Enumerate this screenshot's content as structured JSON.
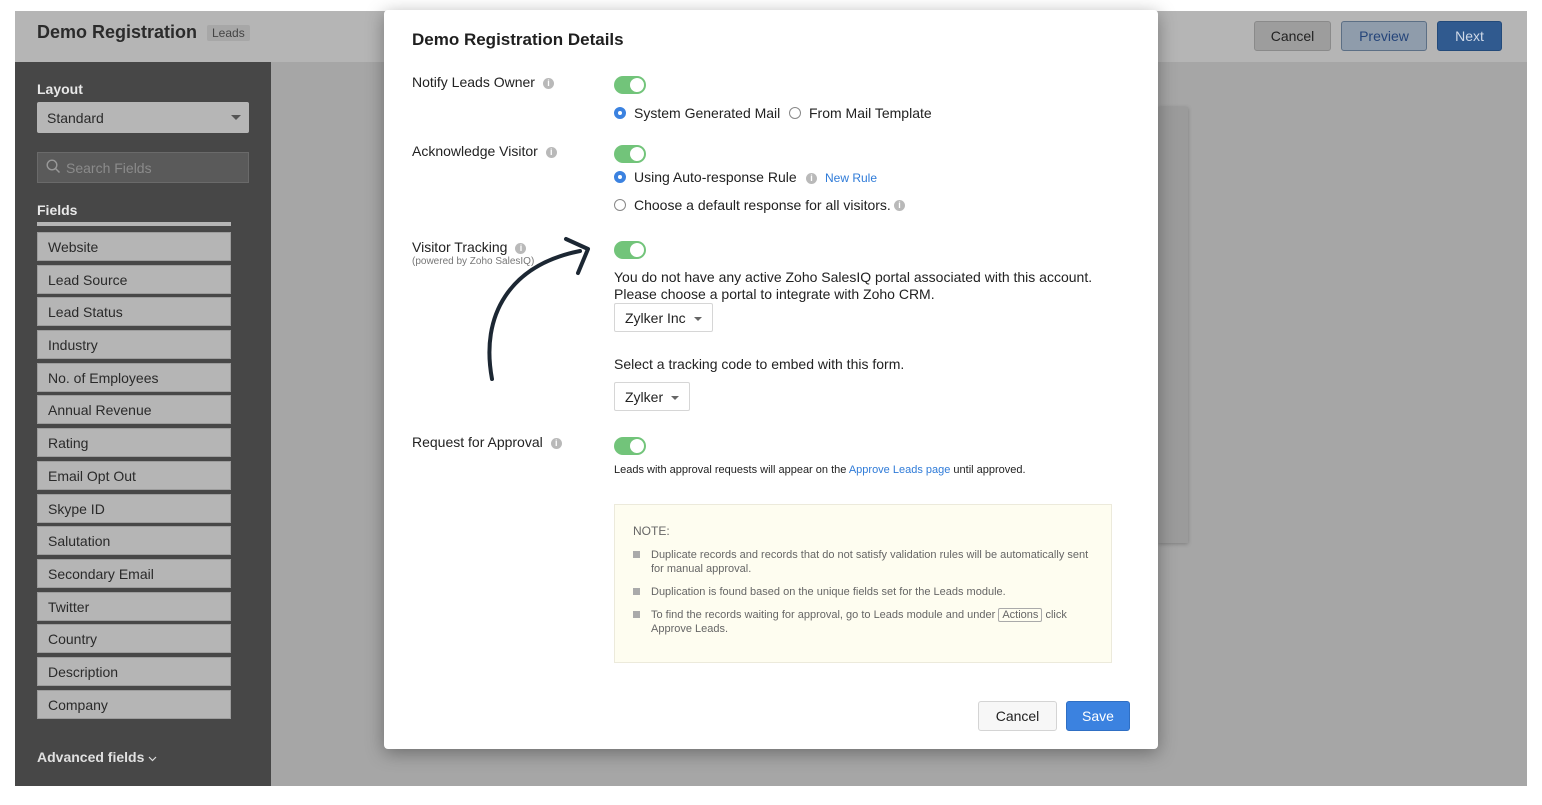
{
  "app": {
    "title": "Demo Registration",
    "module_tag": "Leads",
    "buttons": {
      "cancel": "Cancel",
      "preview": "Preview",
      "next": "Next"
    }
  },
  "sidebar": {
    "layout_label": "Layout",
    "layout_value": "Standard",
    "search_placeholder": "Search Fields",
    "fields_label": "Fields",
    "fields": [
      "Website",
      "Lead Source",
      "Lead Status",
      "Industry",
      "No. of Employees",
      "Annual Revenue",
      "Rating",
      "Email Opt Out",
      "Skype ID",
      "Salutation",
      "Secondary Email",
      "Twitter",
      "Country",
      "Description",
      "Company"
    ],
    "advanced_label": "Advanced fields"
  },
  "modal": {
    "title": "Demo Registration Details",
    "notify": {
      "label": "Notify Leads Owner",
      "enabled": true,
      "option_system": "System Generated Mail",
      "option_template": "From Mail Template",
      "selected": "system"
    },
    "acknowledge": {
      "label": "Acknowledge Visitor",
      "enabled": true,
      "option_auto": "Using Auto-response Rule",
      "new_rule_link": "New Rule",
      "option_default": "Choose a default response for all visitors.",
      "selected": "auto"
    },
    "tracking": {
      "label": "Visitor Tracking",
      "sublabel": "(powered by Zoho SalesIQ)",
      "enabled": true,
      "message": "You do not have any active Zoho SalesIQ portal associated with this account. Please choose a portal to integrate with Zoho CRM.",
      "portal_value": "Zylker Inc",
      "code_prompt": "Select a tracking code to embed with this form.",
      "code_value": "Zylker"
    },
    "approval": {
      "label": "Request for Approval",
      "enabled": true,
      "text_before": "Leads with approval requests will appear on the ",
      "link": "Approve Leads page",
      "text_after": " until approved."
    },
    "note": {
      "title": "NOTE:",
      "item1": "Duplicate records and records that do not satisfy validation rules will be automatically sent for manual approval.",
      "item2": "Duplication is found based on the unique fields set for the Leads module.",
      "item3_before": "To find the records waiting for approval, go to Leads module and under ",
      "item3_kbd": "Actions",
      "item3_mid": " click",
      "item3_bold": "Approve Leads."
    },
    "buttons": {
      "cancel": "Cancel",
      "save": "Save"
    }
  },
  "colors": {
    "accent": "#3b82e0",
    "toggle_on": "#72c47a",
    "note_bg": "#fefdf0"
  }
}
